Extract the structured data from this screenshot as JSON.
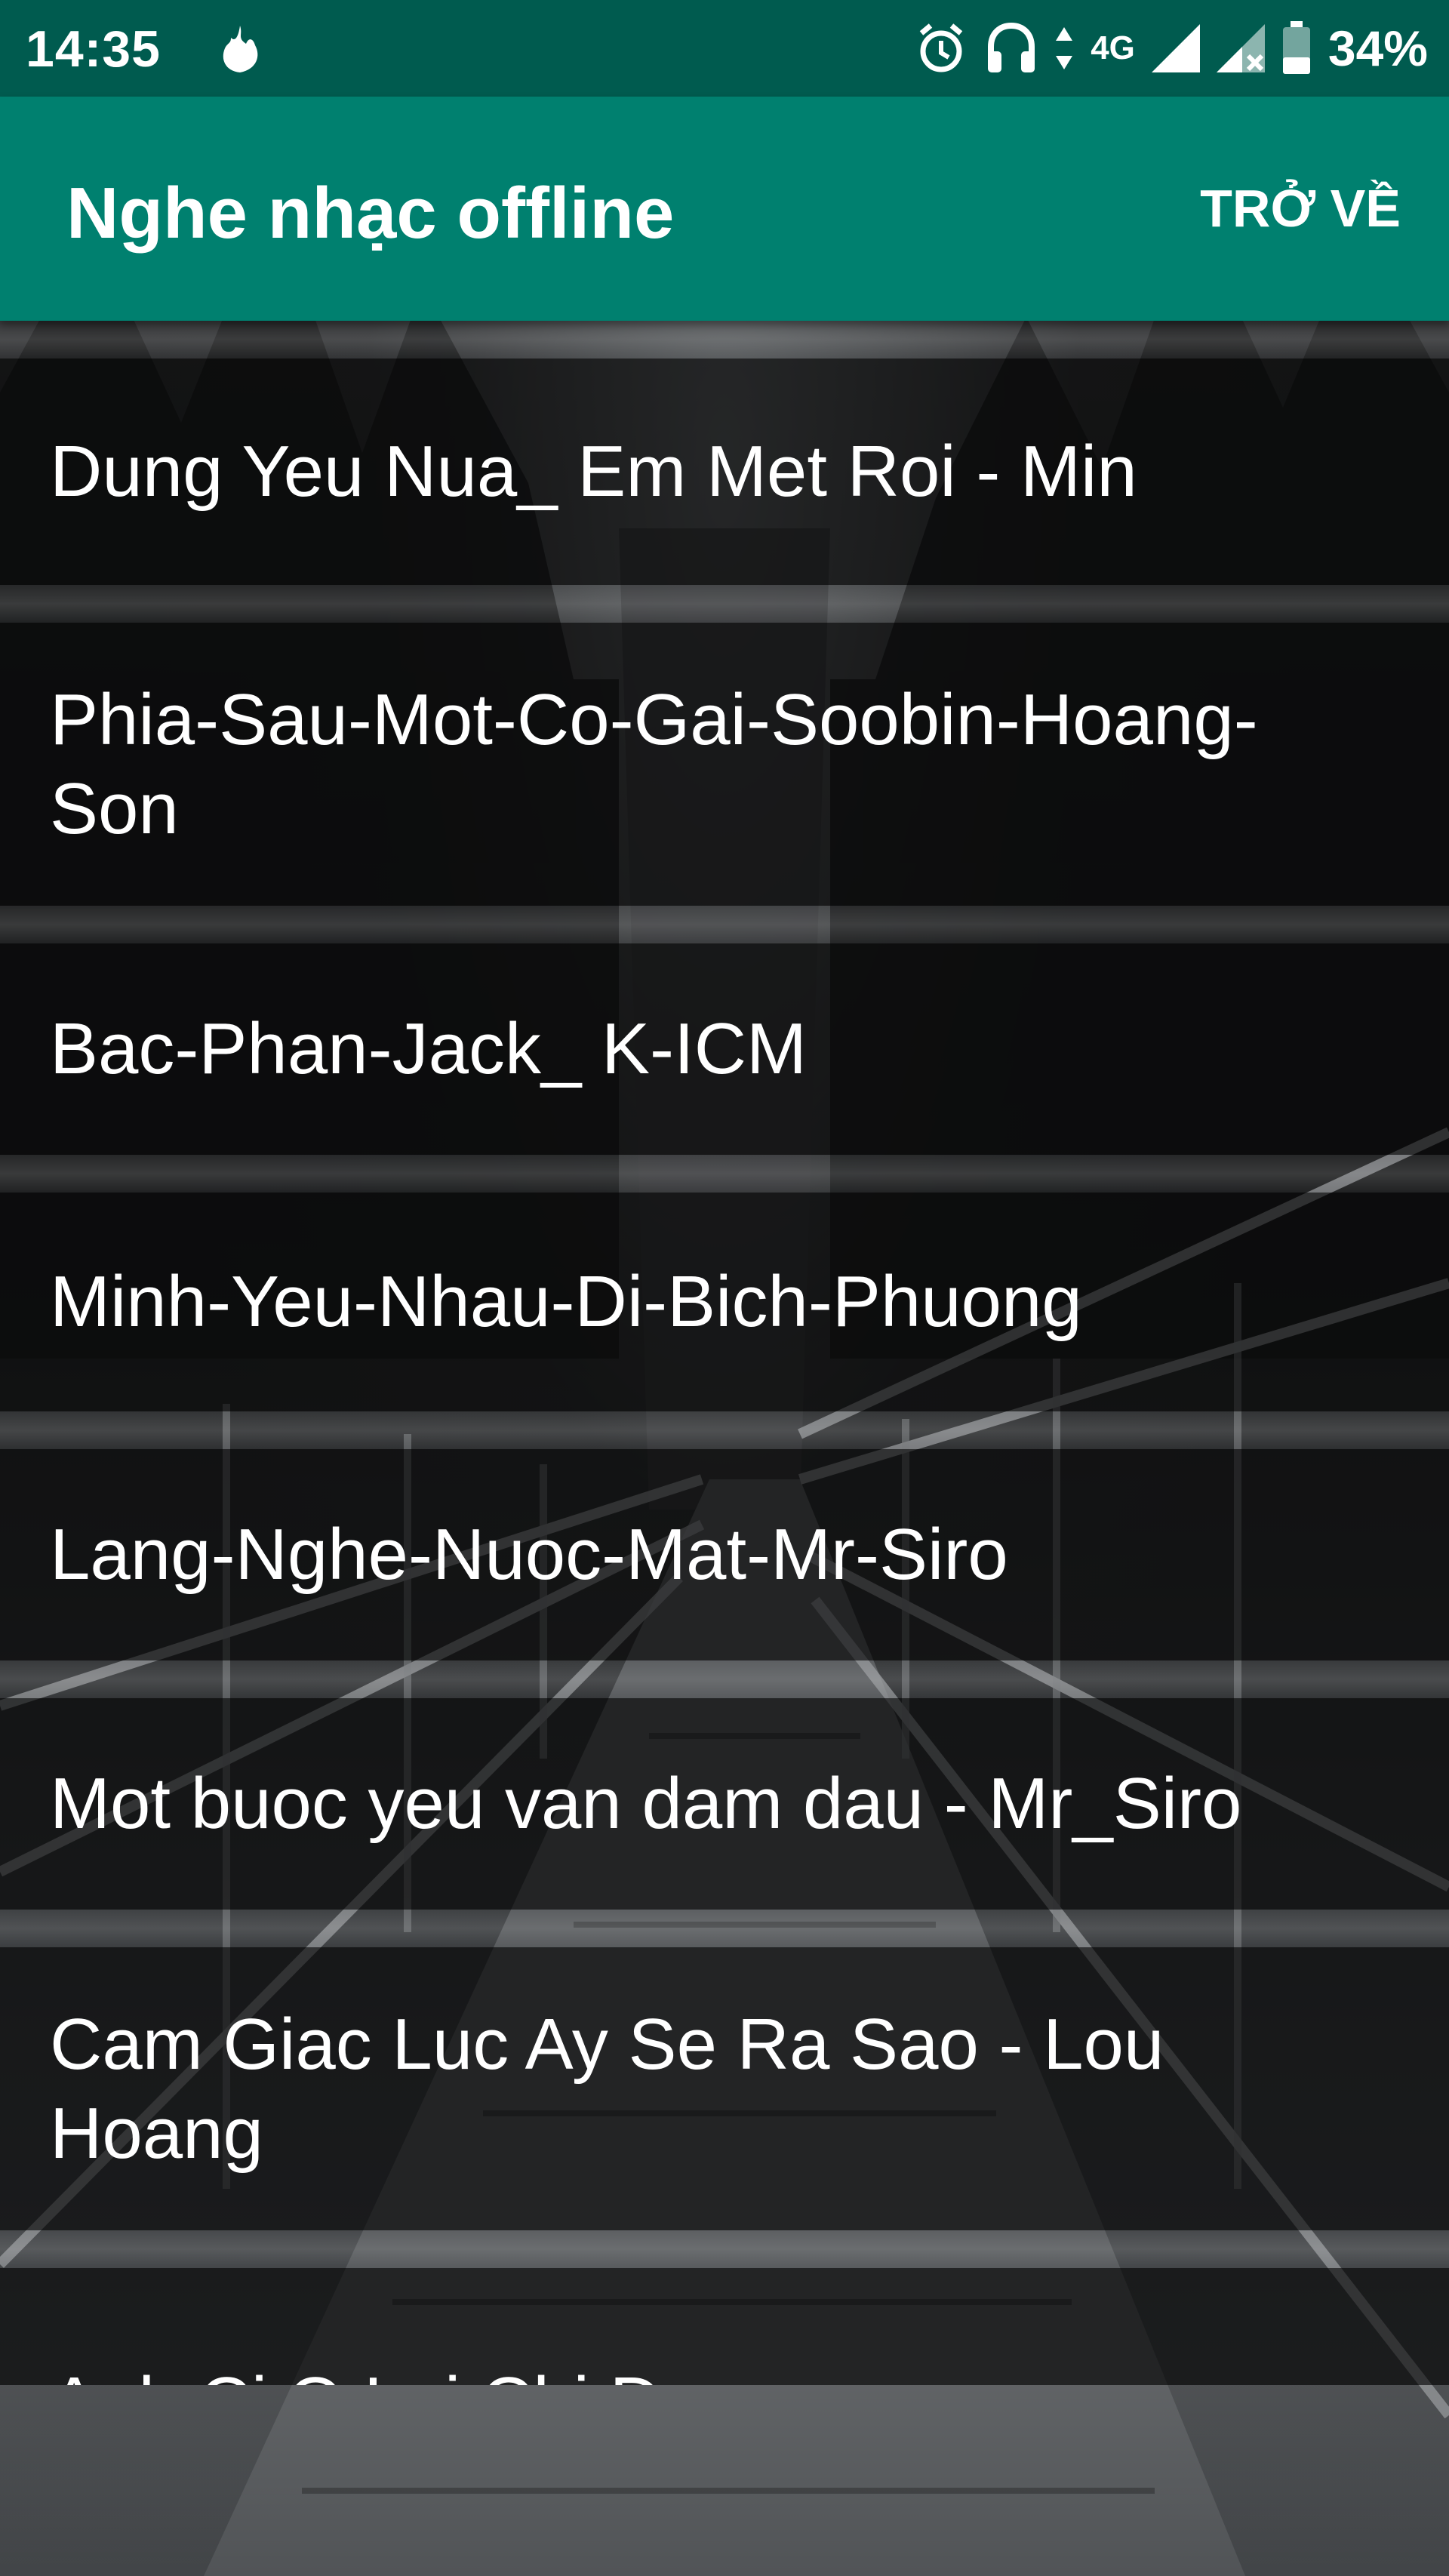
{
  "status_bar": {
    "time": "14:35",
    "network": "4G",
    "battery": "34%",
    "icons": [
      "flame-icon",
      "alarm-icon",
      "headset-icon",
      "data-arrows-icon",
      "signal-icon",
      "signal-no-service-icon",
      "battery-icon"
    ]
  },
  "app_bar": {
    "title": "Nghe nhạc offline",
    "back_label": "TRỞ VỀ"
  },
  "songs": [
    {
      "title": "Dung Yeu Nua_ Em Met Roi - Min"
    },
    {
      "title": "Phia-Sau-Mot-Co-Gai-Soobin-Hoang-Son"
    },
    {
      "title": "Bac-Phan-Jack_ K-ICM"
    },
    {
      "title": "Minh-Yeu-Nhau-Di-Bich-Phuong"
    },
    {
      "title": "Lang-Nghe-Nuoc-Mat-Mr-Siro"
    },
    {
      "title": "Mot buoc yeu van dam dau - Mr_Siro"
    },
    {
      "title": "Cam Giac Luc Ay Se Ra Sao - Lou Hoang"
    },
    {
      "title": "Anh Ci O Lai Chi Du"
    }
  ],
  "colors": {
    "status_bar": "#005b4f",
    "app_bar": "#00806f",
    "text": "#ffffff"
  }
}
